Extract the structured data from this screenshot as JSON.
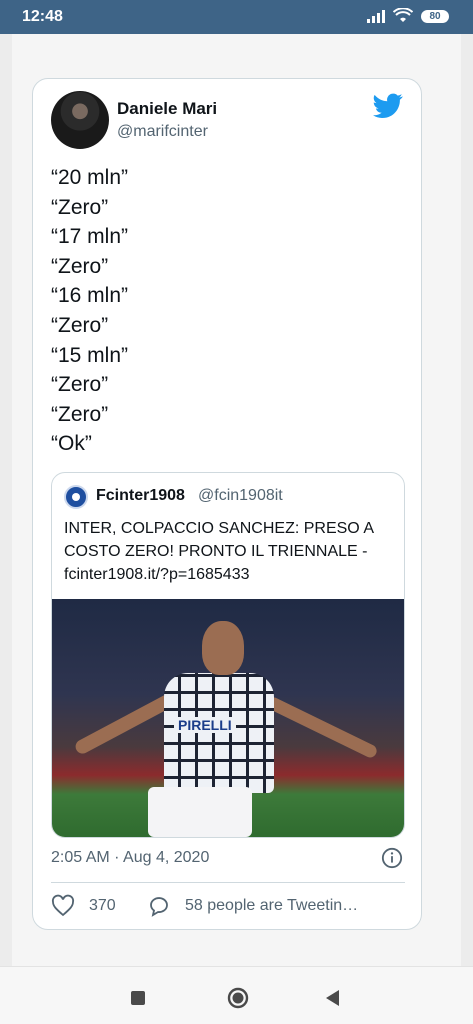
{
  "status_bar": {
    "time": "12:48",
    "battery": "80"
  },
  "tweet": {
    "display_name": "Daniele Mari",
    "handle": "@marifcinter",
    "lines": [
      "“20 mln”",
      "“Zero”",
      "“17 mln”",
      "“Zero”",
      "“16 mln”",
      "“Zero”",
      "“15 mln”",
      "“Zero”",
      "“Zero”",
      "“Ok”"
    ],
    "timestamp": "2:05 AM · Aug 4, 2020",
    "like_count": "370",
    "retweet_text": "58 people are Tweetin…"
  },
  "quote": {
    "name": "Fcinter1908",
    "handle": "@fcin1908it",
    "text": "INTER, COLPACCIO SANCHEZ: PRESO A COSTO ZERO! PRONTO IL TRIENNALE - fcinter1908.it/?p=1685433",
    "image_sponsor": "PIRELLI"
  },
  "colors": {
    "twitter_blue": "#1d9bf0",
    "status_bar": "#3e6487"
  },
  "icons": [
    "signal-icon",
    "wifi-icon",
    "battery-icon",
    "twitter-icon",
    "info-icon",
    "heart-icon",
    "reply-icon"
  ]
}
